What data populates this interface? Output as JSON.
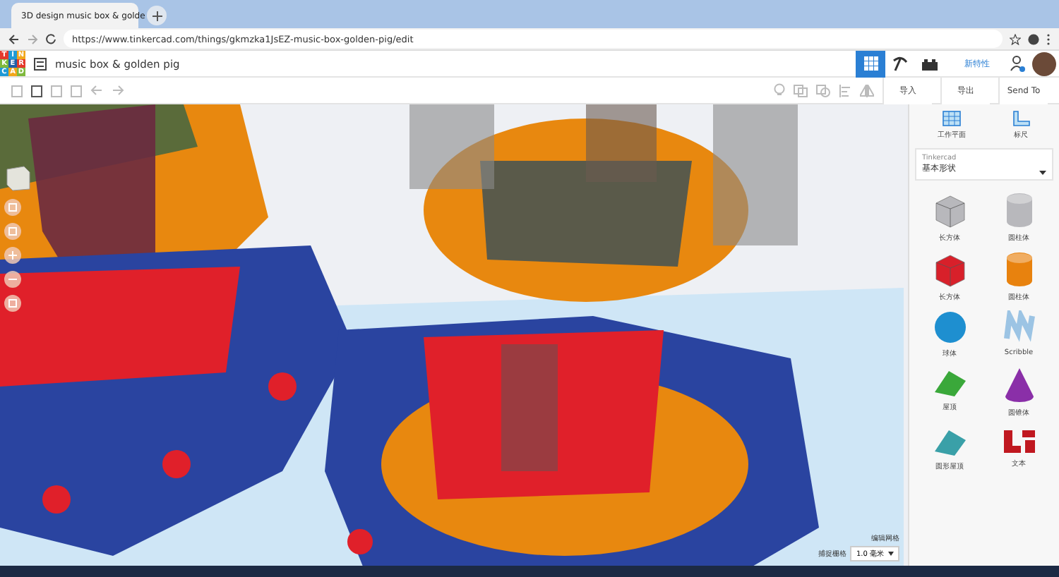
{
  "browser": {
    "tab_title": "3D design music box & golde",
    "url": "https://www.tinkercad.com/things/gkmzka1JsEZ-music-box-golden-pig/edit"
  },
  "app": {
    "logo_letters": [
      "T",
      "I",
      "N",
      "K",
      "E",
      "R",
      "C",
      "A",
      "D"
    ],
    "design_title": "music box & golden pig",
    "header_link": "新特性"
  },
  "toolbar": {
    "actions": [
      "导入",
      "导出",
      "Send To"
    ]
  },
  "panel": {
    "tools": [
      {
        "label": "工作平面",
        "kind": "workplane"
      },
      {
        "label": "标尺",
        "kind": "ruler"
      }
    ],
    "library": {
      "source": "Tinkercad",
      "category": "基本形状"
    },
    "shapes": [
      {
        "label": "长方体",
        "kind": "box",
        "color": "#b8b8bc"
      },
      {
        "label": "圆柱体",
        "kind": "cylinder",
        "color": "#b8b8bc"
      },
      {
        "label": "长方体",
        "kind": "box",
        "color": "#d8202a"
      },
      {
        "label": "圆柱体",
        "kind": "cylinder",
        "color": "#e8820e"
      },
      {
        "label": "球体",
        "kind": "sphere",
        "color": "#1e8fd0"
      },
      {
        "label": "Scribble",
        "kind": "scribble",
        "color": "#9cc4e4"
      },
      {
        "label": "屋顶",
        "kind": "roof",
        "color": "#3aa83a"
      },
      {
        "label": "圆锥体",
        "kind": "cone",
        "color": "#8a2fa8"
      },
      {
        "label": "圆形屋顶",
        "kind": "roof",
        "color": "#3aa0a8"
      },
      {
        "label": "文本",
        "kind": "text",
        "color": "#c01820"
      }
    ]
  },
  "grid": {
    "edit_label": "编辑网格",
    "snap_label": "捕捉栅格",
    "snap_value": "1.0 毫米"
  }
}
